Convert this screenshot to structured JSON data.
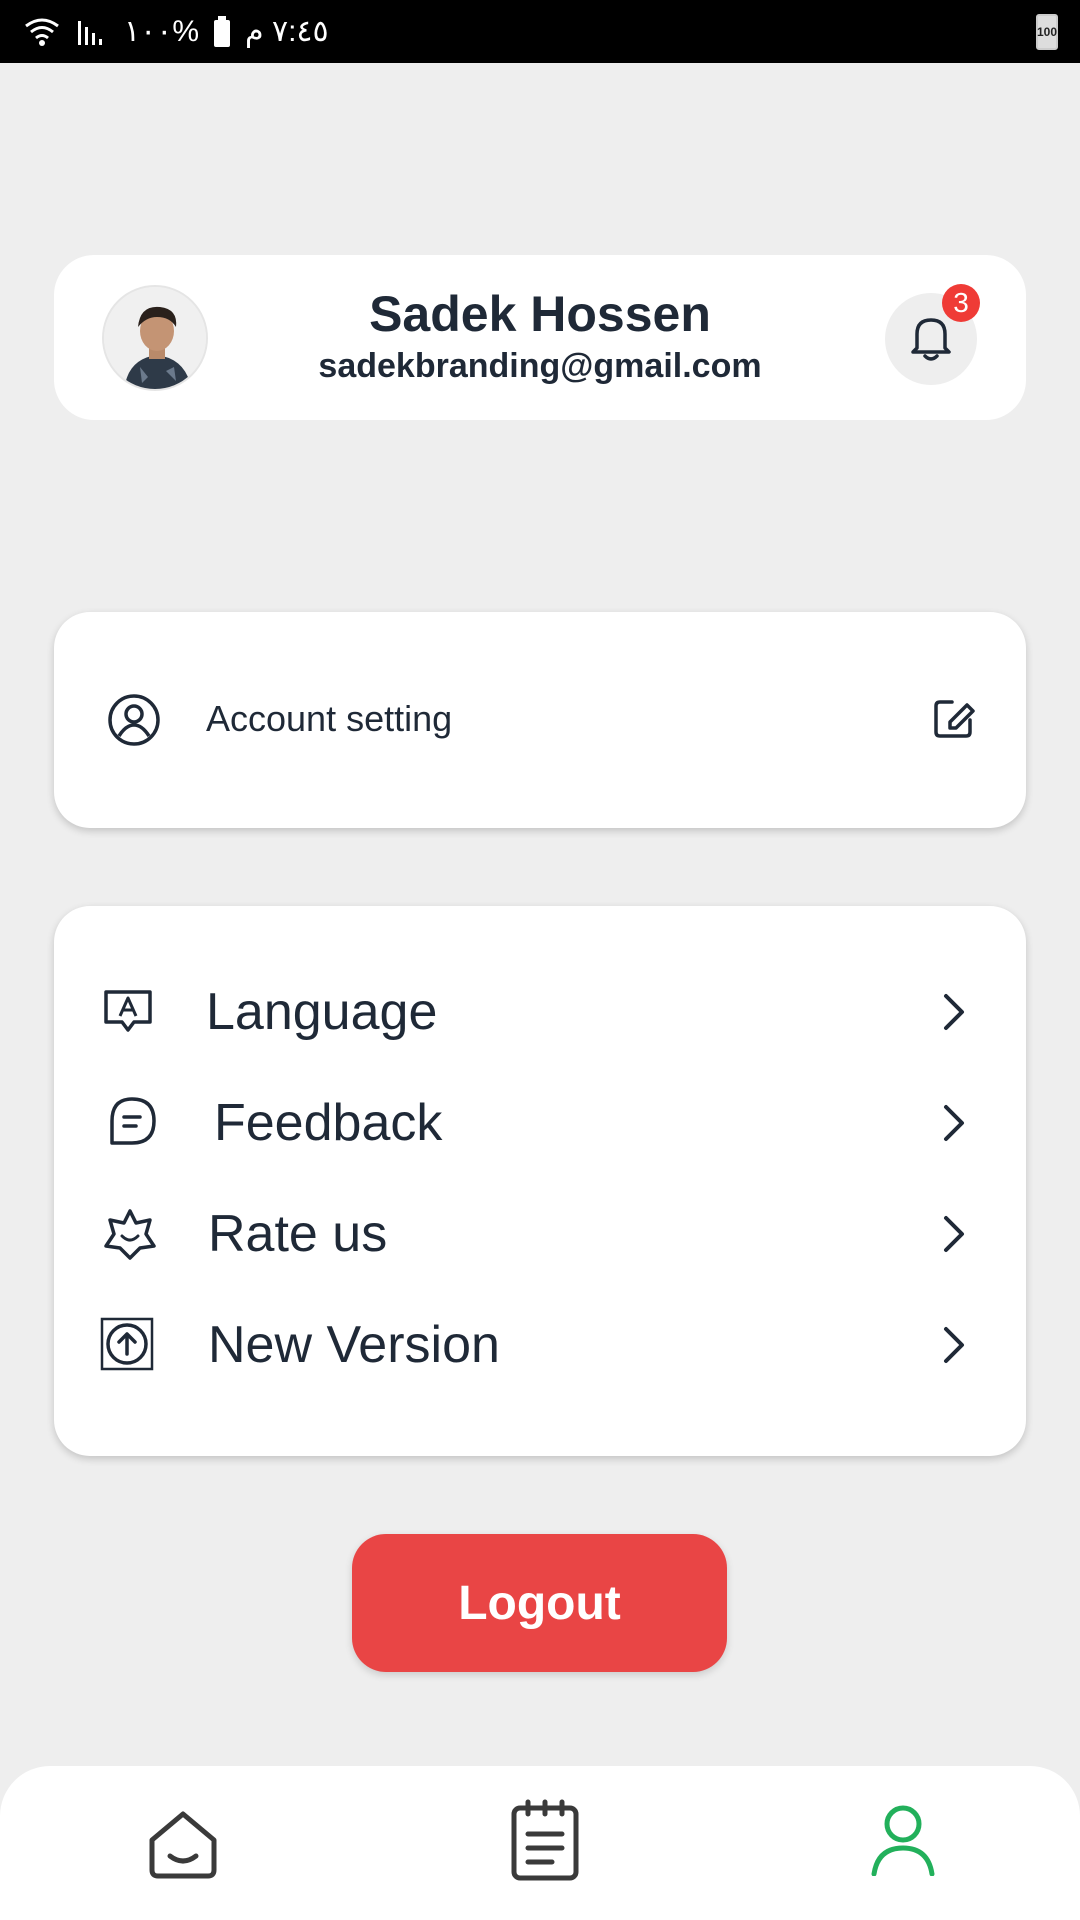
{
  "status_bar": {
    "time": "٧:٤٥ م",
    "battery_percent": "%١٠٠",
    "battery_right": "100",
    "icons": [
      "battery-icon",
      "signal-icon",
      "wifi-icon"
    ]
  },
  "profile": {
    "name": "Sadek Hossen",
    "email": "sadekbranding@gmail.com",
    "notification_count": "3"
  },
  "account": {
    "label": "Account setting"
  },
  "menu": {
    "items": [
      {
        "label": "Language",
        "icon": "language-icon"
      },
      {
        "label": "Feedback",
        "icon": "feedback-icon"
      },
      {
        "label": "Rate us",
        "icon": "star-icon"
      },
      {
        "label": "New Version",
        "icon": "upload-icon"
      }
    ]
  },
  "logout": {
    "label": "Logout"
  },
  "bottom_nav": {
    "items": [
      "home-icon",
      "notes-icon",
      "profile-icon"
    ],
    "active": "profile-icon"
  },
  "colors": {
    "accent_green": "#22b05b",
    "logout_red": "#e94545",
    "badge_red": "#ef3b36",
    "text_dark": "#1f2937",
    "background": "#eeeeee"
  }
}
